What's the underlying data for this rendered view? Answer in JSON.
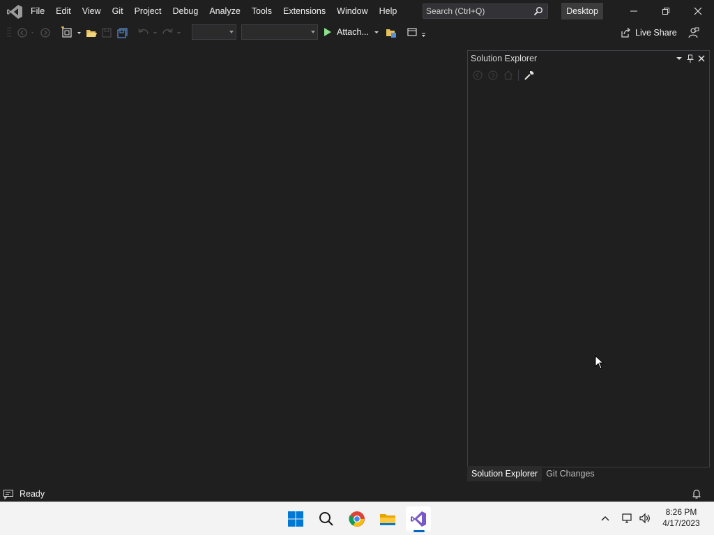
{
  "menu": {
    "items": [
      "File",
      "Edit",
      "View",
      "Git",
      "Project",
      "Debug",
      "Analyze",
      "Tools",
      "Extensions",
      "Window",
      "Help"
    ]
  },
  "search": {
    "placeholder": "Search (Ctrl+Q)"
  },
  "layout_badge": "Desktop",
  "toolbar": {
    "attach_label": "Attach...",
    "live_share_label": "Live Share",
    "config_combo_value": "",
    "platform_combo_value": ""
  },
  "solution_explorer": {
    "title": "Solution Explorer"
  },
  "panel_tabs": [
    "Solution Explorer",
    "Git Changes"
  ],
  "status": {
    "text": "Ready"
  },
  "taskbar": {
    "apps": [
      "start-icon",
      "search-icon",
      "chrome-icon",
      "file-explorer-icon",
      "visual-studio-icon"
    ],
    "clock_time": "8:26 PM",
    "clock_date": "4/17/2023"
  },
  "colors": {
    "background": "#1f1f1f",
    "accent": "#0067c0",
    "play_green": "#8ae28a",
    "vs_purple": "#7a59c7"
  }
}
